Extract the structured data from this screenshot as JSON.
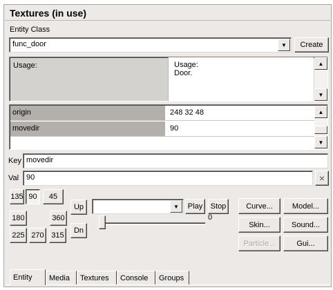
{
  "panel": {
    "title": "Textures (in use)",
    "entity_class_label": "Entity Class",
    "entity_class_value": "func_door",
    "create_button": "Create"
  },
  "usage": {
    "left": "Usage:",
    "right_line1": "Usage:",
    "right_line2": "Door."
  },
  "keyvals": {
    "rows": [
      {
        "key": "origin",
        "value": "248 32 48"
      },
      {
        "key": "movedir",
        "value": "90"
      }
    ]
  },
  "key_field": {
    "label": "Key",
    "value": "movedir"
  },
  "val_field": {
    "label": "Val",
    "value": "90",
    "clear_button": "×"
  },
  "angles": [
    "135",
    "90",
    "45",
    "180",
    "360",
    "225",
    "270",
    "315"
  ],
  "selected_angle": "90",
  "sound": {
    "up_button": "Up",
    "down_button": "Dn",
    "select_value": "",
    "play_button": "Play",
    "stop_button": "Stop",
    "slider_value": "0"
  },
  "actions": {
    "curve": "Curve...",
    "model": "Model...",
    "skin": "Skin...",
    "sound": "Sound...",
    "particle": "Particle...",
    "gui": "Gui..."
  },
  "tabs": [
    "Entity",
    "Media",
    "Textures",
    "Console",
    "Groups"
  ],
  "active_tab": "Entity",
  "colors": {
    "panel_bg": "#ece9e6",
    "key_cell_bg": "#b3b0ac",
    "usage_bg": "#d4d2cf"
  }
}
